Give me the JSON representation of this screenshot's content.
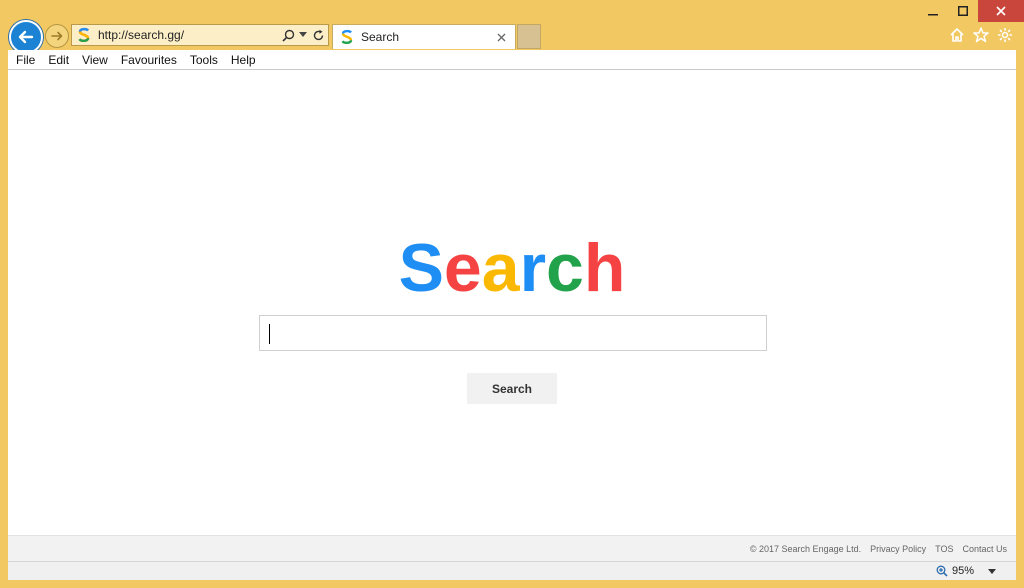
{
  "window": {
    "minimize_icon": "minimize-icon",
    "maximize_icon": "maximize-icon",
    "close_icon": "close-icon"
  },
  "nav": {
    "url": "http://search.gg/",
    "back_icon": "back-arrow-icon",
    "forward_icon": "forward-arrow-icon",
    "favicon_letter": "S",
    "colors": {
      "accent_back": "#1c83d4",
      "frame": "#f1c862"
    }
  },
  "tab": {
    "label": "Search",
    "favicon_letter": "S"
  },
  "menu": {
    "items": [
      "File",
      "Edit",
      "View",
      "Favourites",
      "Tools",
      "Help"
    ]
  },
  "logo": {
    "letters": [
      {
        "char": "S",
        "color": "#1e8ef5"
      },
      {
        "char": "e",
        "color": "#f54343"
      },
      {
        "char": "a",
        "color": "#fbb800"
      },
      {
        "char": "r",
        "color": "#1e8ef5"
      },
      {
        "char": "c",
        "color": "#22a24a"
      },
      {
        "char": "h",
        "color": "#f54343"
      }
    ]
  },
  "search": {
    "input_value": "",
    "button_label": "Search"
  },
  "footer": {
    "copyright": "© 2017 Search Engage Ltd.",
    "links": [
      "Privacy Policy",
      "TOS",
      "Contact Us"
    ]
  },
  "status": {
    "zoom": "95%"
  }
}
